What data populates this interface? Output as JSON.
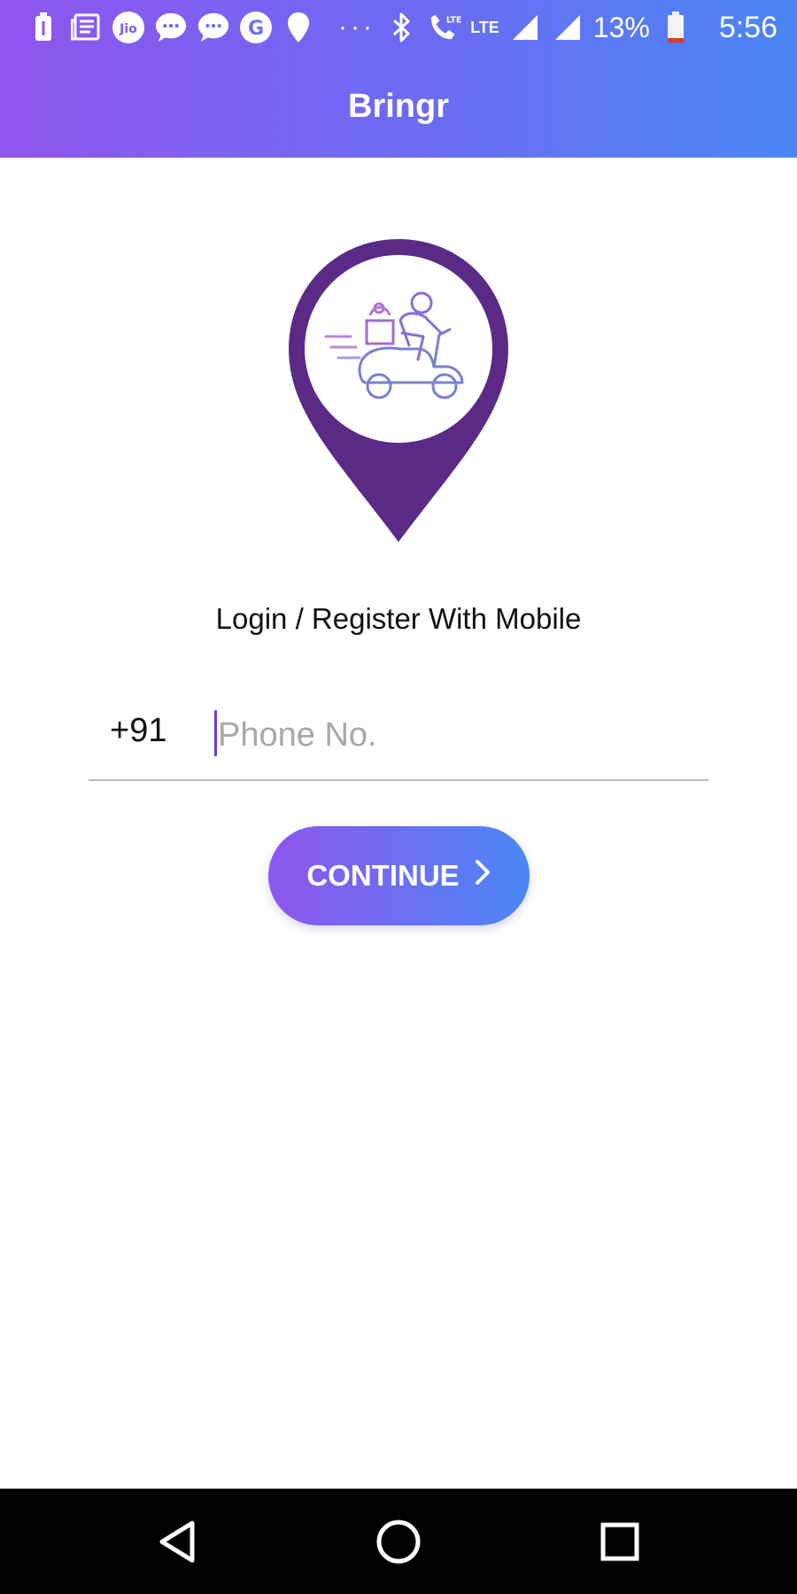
{
  "status_bar": {
    "icons_left": [
      "battery-saver-icon",
      "news-icon",
      "jio-icon",
      "message-icon",
      "message-icon",
      "google-icon",
      "location-icon"
    ],
    "more_dots": "···",
    "lte_label": "LTE",
    "battery_percent": "13%",
    "time": "5:56"
  },
  "app_bar": {
    "title": "Bringr"
  },
  "login": {
    "headline": "Login / Register With Mobile",
    "country_code": "+91",
    "phone_value": "",
    "phone_placeholder": "Phone No.",
    "continue_label": "CONTINUE"
  },
  "logo": {
    "icon": "delivery-scooter-pin-icon"
  },
  "nav_bar": {
    "items": [
      "back-icon",
      "home-icon",
      "recents-icon"
    ]
  },
  "colors": {
    "gradient_start": "#8f55ee",
    "gradient_end": "#4a87f5",
    "pin": "#5b2a86",
    "cursor": "#6a3fd6"
  }
}
